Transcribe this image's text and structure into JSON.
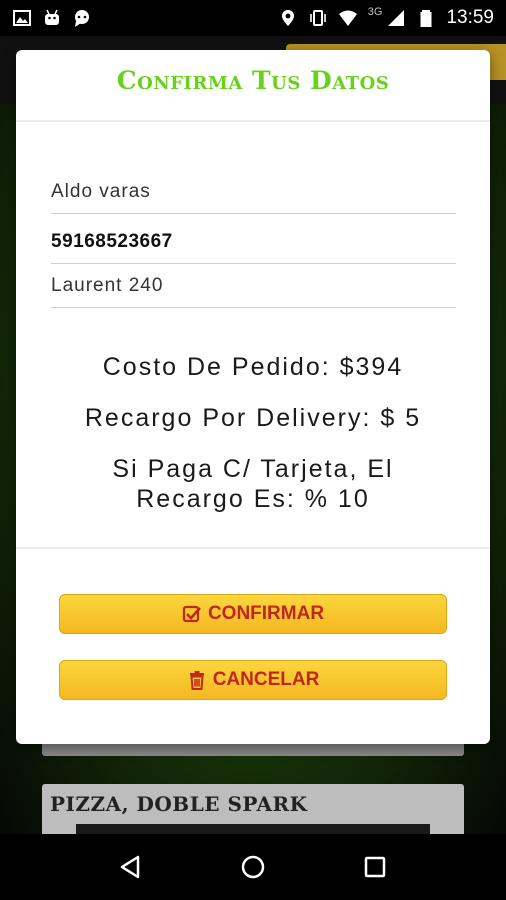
{
  "status_bar": {
    "time": "13:59",
    "network": "3G",
    "icons": [
      "image-icon",
      "android-icon",
      "chat-icon",
      "location-icon",
      "vibrate-icon",
      "wifi-icon",
      "signal-icon",
      "battery-icon"
    ]
  },
  "modal": {
    "title": "Confirma Tus Datos",
    "fields": {
      "name": "Aldo varas",
      "phone": "59168523667",
      "address": "Laurent 240"
    },
    "info": {
      "order_cost": "Costo De Pedido: $394",
      "delivery_fee": "Recargo Por Delivery: $ 5",
      "card_fee_line1": "Si Paga C/ Tarjeta, El",
      "card_fee_line2": "Recargo Es: % 10"
    },
    "buttons": {
      "confirm_label": "CONFIRMAR",
      "confirm_icon": "check-square-icon",
      "cancel_label": "CANCELAR",
      "cancel_icon": "trash-icon"
    }
  },
  "background": {
    "card_title": "PIZZA, DOBLE SPARK"
  },
  "nav_bar": {
    "icons": [
      "back-icon",
      "home-icon",
      "recents-icon"
    ]
  },
  "colors": {
    "title_green": "#6ad11b",
    "button_yellow": "#f7c22c",
    "button_text_red": "#c02720"
  }
}
